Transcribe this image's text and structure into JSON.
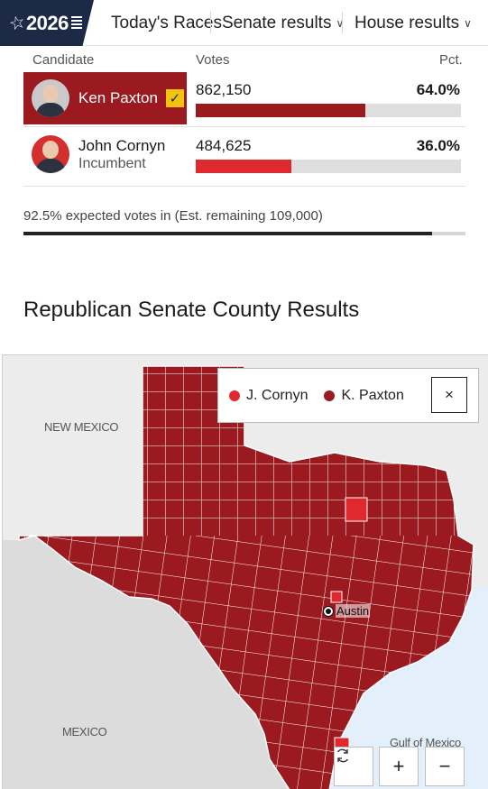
{
  "nav": {
    "logo_year": "2026",
    "items": [
      "Today's Races",
      "Senate results",
      "House results"
    ]
  },
  "table": {
    "headers": {
      "candidate": "Candidate",
      "votes": "Votes",
      "pct": "Pct."
    },
    "candidates": [
      {
        "name": "Ken Paxton",
        "subtitle": "",
        "votes": "862,150",
        "pct": "64.0%",
        "share": 0.64,
        "winner": true,
        "bar_color": "#9a1a1f"
      },
      {
        "name": "John Cornyn",
        "subtitle": "Incumbent",
        "votes": "484,625",
        "pct": "36.0%",
        "share": 0.36,
        "winner": false,
        "bar_color": "#e0282f"
      }
    ],
    "expected_text": "92.5% expected votes in (Est. remaining 109,000)",
    "expected_share": 0.925
  },
  "section_title": "Republican Senate County Results",
  "map": {
    "legend": [
      {
        "label": "J. Cornyn",
        "color": "#e0282f"
      },
      {
        "label": "K. Paxton",
        "color": "#9a1a1f"
      }
    ],
    "labels": {
      "new_mexico": "NEW MEXICO",
      "mexico": "MEXICO",
      "gulf": "Gulf of Mexico",
      "city": "Austin"
    },
    "controls": {
      "reset_icon": "refresh-icon",
      "zoom_in": "+",
      "zoom_out": "−",
      "close": "×"
    },
    "colors": {
      "state_fill": "#9a1a1f",
      "highlight_fill": "#e0282f",
      "water": "#e3f0fb",
      "land": "#ececec"
    }
  }
}
